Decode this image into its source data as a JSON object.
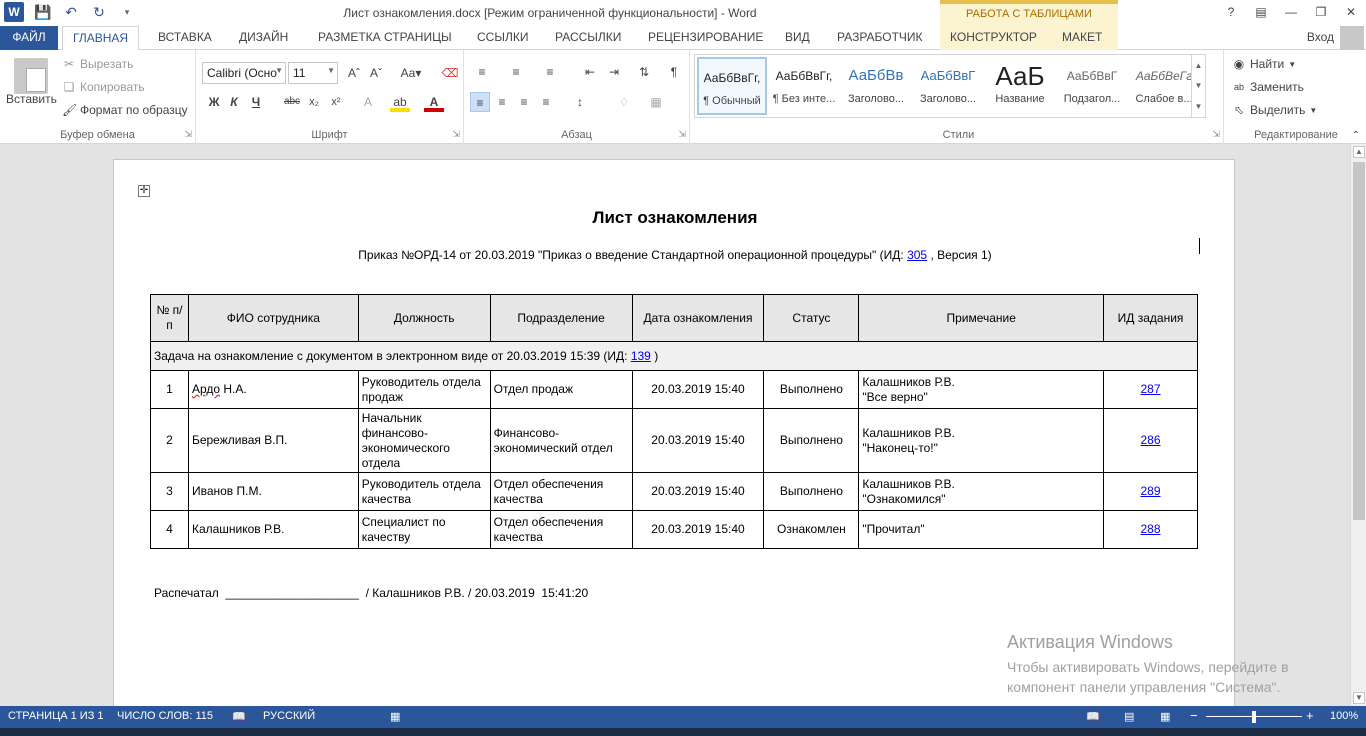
{
  "window": {
    "title": "Лист ознакомления.docx [Режим ограниченной функциональности] - Word",
    "contextual_group": "РАБОТА С ТАБЛИЦАМИ",
    "sign_in": "Вход"
  },
  "tabs": [
    {
      "label": "ФАЙЛ"
    },
    {
      "label": "ГЛАВНАЯ"
    },
    {
      "label": "ВСТАВКА"
    },
    {
      "label": "ДИЗАЙН"
    },
    {
      "label": "РАЗМЕТКА СТРАНИЦЫ"
    },
    {
      "label": "ССЫЛКИ"
    },
    {
      "label": "РАССЫЛКИ"
    },
    {
      "label": "РЕЦЕНЗИРОВАНИЕ"
    },
    {
      "label": "ВИД"
    },
    {
      "label": "РАЗРАБОТЧИК"
    },
    {
      "label": "КОНСТРУКТОР"
    },
    {
      "label": "МАКЕТ"
    }
  ],
  "clipboard": {
    "paste": "Вставить",
    "cut": "Вырезать",
    "copy": "Копировать",
    "format_painter": "Формат по образцу",
    "group_label": "Буфер обмена"
  },
  "font": {
    "name": "Calibri (Осно",
    "size": "11",
    "group_label": "Шрифт"
  },
  "paragraph": {
    "group_label": "Абзац"
  },
  "styles": {
    "group_label": "Стили",
    "items": [
      {
        "sample": "АаБбВвГг,",
        "name": "¶ Обычный"
      },
      {
        "sample": "АаБбВвГг,",
        "name": "¶ Без инте..."
      },
      {
        "sample": "АаБбВв",
        "name": "Заголово..."
      },
      {
        "sample": "АаБбВвГ",
        "name": "Заголово..."
      },
      {
        "sample": "АаБ",
        "name": "Название"
      },
      {
        "sample": "АаБбВвГ",
        "name": "Подзагол..."
      },
      {
        "sample": "АаБбВеГг",
        "name": "Слабое в..."
      }
    ]
  },
  "editing": {
    "find": "Найти",
    "replace": "Заменить",
    "select": "Выделить",
    "group_label": "Редактирование"
  },
  "document": {
    "title": "Лист ознакомления",
    "subtitle_pre": "Приказ №ОРД-14 от 20.03.2019 \"Приказ о введение Стандартной операционной процедуры\" (ИД:",
    "subtitle_id": "305",
    "subtitle_post": ", Версия 1)",
    "columns": [
      "№ п/п",
      "ФИО сотрудника",
      "Должность",
      "Подразделение",
      "Дата ознакомления",
      "Статус",
      "Примечание",
      "ИД задания"
    ],
    "task_pre": "Задача на ознакомление с документом в электронном виде от 20.03.2019 15:39 (ИД:",
    "task_id": "139",
    "task_post": ")",
    "rows": [
      {
        "n": "1",
        "name_sq": "Ардо",
        "name_rest": " Н.А.",
        "position": "Руководитель отдела продаж",
        "dept": "Отдел продаж",
        "date": "20.03.2019 15:40",
        "status": "Выполнено",
        "note1": "Калашников Р.В.",
        "note2": "\"Все верно\"",
        "task": "287"
      },
      {
        "n": "2",
        "name_sq": "",
        "name_rest": "Бережливая В.П.",
        "position": "Начальник финансово-экономического отдела",
        "dept": "Финансово-экономический отдел",
        "date": "20.03.2019 15:40",
        "status": "Выполнено",
        "note1": "Калашников Р.В.",
        "note2": "\"Наконец-то!\"",
        "task": "286"
      },
      {
        "n": "3",
        "name_sq": "",
        "name_rest": "Иванов П.М.",
        "position": "Руководитель отдела качества",
        "dept": "Отдел обеспечения качества",
        "date": "20.03.2019 15:40",
        "status": "Выполнено",
        "note1": "Калашников Р.В.",
        "note2": "\"Ознакомился\"",
        "task": "289"
      },
      {
        "n": "4",
        "name_sq": "",
        "name_rest": "Калашников Р.В.",
        "position": "Специалист по качеству",
        "dept": "Отдел обеспечения качества",
        "date": "20.03.2019 15:40",
        "status": "Ознакомлен",
        "note1": "",
        "note2": "\"Прочитал\"",
        "task": "288"
      }
    ],
    "printed": "Распечатал  ____________________  / Калашников Р.В. / 20.03.2019  15:41:20"
  },
  "activation": {
    "title": "Активация Windows",
    "line1": "Чтобы активировать Windows, перейдите в",
    "line2": "компонент панели управления \"Система\"."
  },
  "status": {
    "page": "СТРАНИЦА 1 ИЗ 1",
    "words": "ЧИСЛО СЛОВ: 115",
    "language": "РУССКИЙ",
    "zoom": "100%",
    "zoom_level": 0.5
  }
}
